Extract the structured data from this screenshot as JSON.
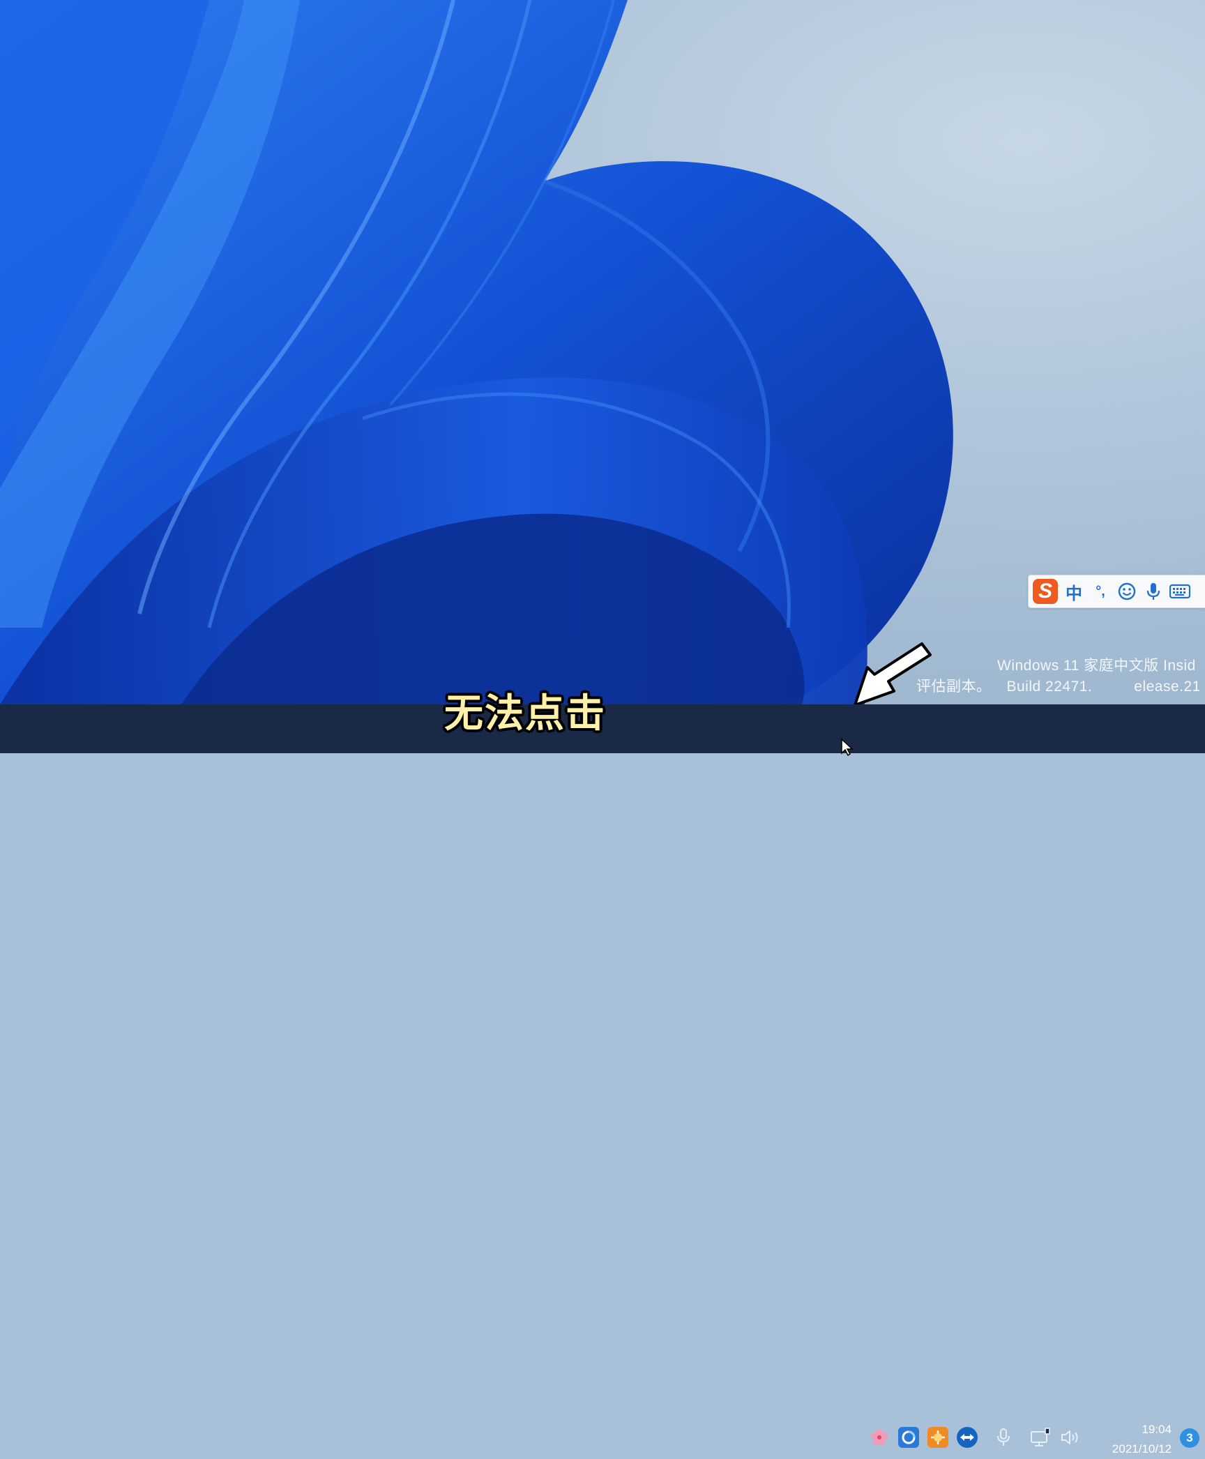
{
  "desktop": {
    "watermark": {
      "line1": "Windows 11 家庭中文版 Insid",
      "line2_prefix": "评估副本。",
      "line2_build": "Build 22471.",
      "line2_suffix": "elease.21"
    }
  },
  "ime_toolbar": {
    "logo": "S",
    "mode_label": "中",
    "punctuation_label": "°,",
    "icons": [
      "sogou-logo-icon",
      "emoji-icon",
      "microphone-icon",
      "keyboard-icon"
    ]
  },
  "subtitle": {
    "text": "无法点击"
  },
  "taskbar": {
    "tray_icons": [
      "sakura-app-icon",
      "browser-app-icon",
      "settings-app-icon",
      "teamviewer-icon",
      "microphone-icon",
      "network-icon",
      "volume-icon"
    ],
    "clock": {
      "time": "19:04",
      "date": "2021/10/12"
    },
    "notification_count": "3"
  },
  "colors": {
    "taskbar": "#1a2a46",
    "subtitle": "#fff2a8",
    "ime_accent": "#ef5a1f",
    "badge": "#2f8fe0"
  }
}
